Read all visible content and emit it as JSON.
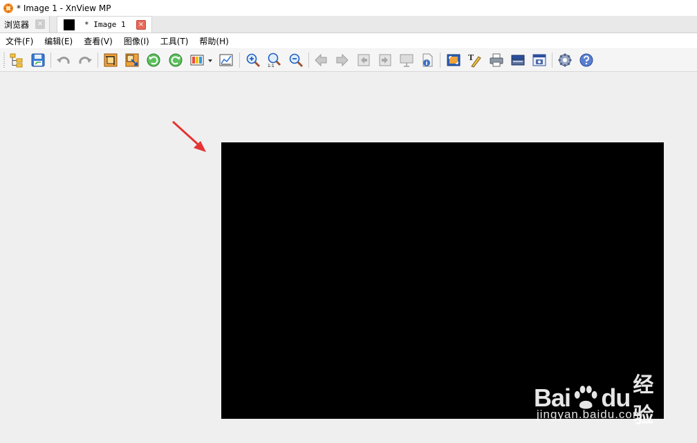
{
  "window": {
    "title": "* Image 1 - XnView MP"
  },
  "tabs": [
    {
      "label": "浏览器",
      "close": "×"
    },
    {
      "label": "* Image 1",
      "close": "×"
    }
  ],
  "menu": [
    "文件(F)",
    "编辑(E)",
    "查看(V)",
    "图像(I)",
    "工具(T)",
    "帮助(H)"
  ],
  "toolbar": {
    "icons": [
      "browser-tree-icon",
      "save-icon",
      "undo-icon",
      "redo-icon",
      "crop-icon",
      "resize-icon",
      "rotate-left-icon",
      "rotate-right-icon",
      "adjust-colors-icon",
      "dropdown-arrow-icon",
      "levels-icon",
      "zoom-in-icon",
      "zoom-1to1-icon",
      "zoom-out-icon",
      "previous-icon",
      "next-icon",
      "first-image-icon",
      "last-image-icon",
      "slideshow-icon",
      "properties-icon",
      "fullscreen-icon",
      "add-text-icon",
      "print-icon",
      "scan-icon",
      "capture-icon",
      "settings-icon",
      "help-icon"
    ]
  },
  "canvas": {
    "fill": "#000000"
  },
  "watermark": {
    "brand_left": "Bai",
    "brand_right": "du",
    "brand_cn": "经验",
    "url": "jingyan.baidu.com"
  },
  "colors": {
    "annotation_arrow": "#e53333",
    "close_active": "#e8685a"
  }
}
